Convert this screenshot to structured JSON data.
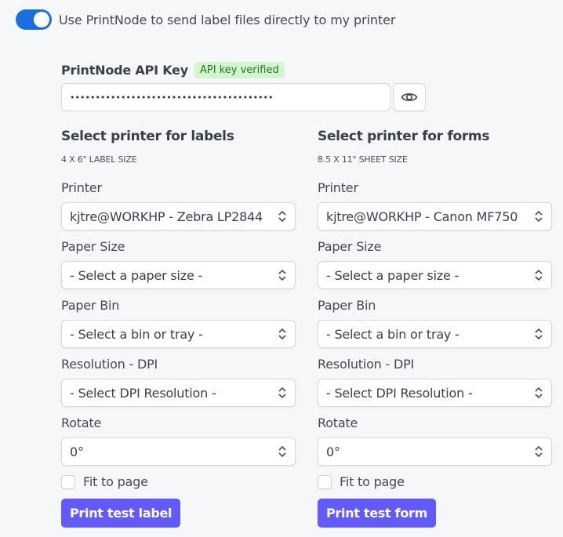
{
  "toggle": {
    "label": "Use PrintNode to send label files directly to my printer",
    "on": true,
    "color": "#1a6fe0"
  },
  "api": {
    "title": "PrintNode API Key",
    "badge": "API key verified",
    "value": "••••••••••••••••••••••••••••••••••••••••",
    "reveal_icon": "eye-icon"
  },
  "labels": {
    "title": "Select printer for labels",
    "subtitle": "4 X 6\" LABEL SIZE",
    "printer_label": "Printer",
    "printer_value": "kjtre@WORKHP - Zebra LP2844",
    "paper_size_label": "Paper Size",
    "paper_size_value": "- Select a paper size -",
    "paper_bin_label": "Paper Bin",
    "paper_bin_value": "- Select a bin or tray -",
    "dpi_label": "Resolution - DPI",
    "dpi_value": "- Select DPI Resolution -",
    "rotate_label": "Rotate",
    "rotate_value": "0°",
    "fit_label": "Fit to page",
    "fit_checked": false,
    "button": "Print test label"
  },
  "forms": {
    "title": "Select printer for forms",
    "subtitle": "8.5 X 11\" SHEET SIZE",
    "printer_label": "Printer",
    "printer_value": "kjtre@WORKHP - Canon MF750",
    "paper_size_label": "Paper Size",
    "paper_size_value": "- Select a paper size -",
    "paper_bin_label": "Paper Bin",
    "paper_bin_value": "- Select a bin or tray -",
    "dpi_label": "Resolution - DPI",
    "dpi_value": "- Select DPI Resolution -",
    "rotate_label": "Rotate",
    "rotate_value": "0°",
    "fit_label": "Fit to page",
    "fit_checked": false,
    "button": "Print test form"
  },
  "colors": {
    "accent_button": "#625afa",
    "badge_bg": "#d3f5cf",
    "badge_text": "#1f7a1f",
    "background": "#f6f7f9"
  }
}
